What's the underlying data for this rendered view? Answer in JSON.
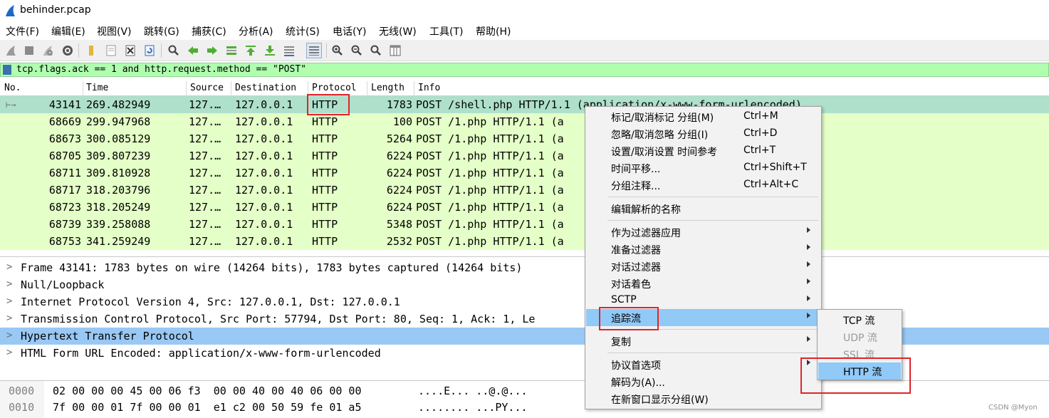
{
  "window": {
    "title": "behinder.pcap"
  },
  "menu": [
    "文件(F)",
    "编辑(E)",
    "视图(V)",
    "跳转(G)",
    "捕获(C)",
    "分析(A)",
    "统计(S)",
    "电话(Y)",
    "无线(W)",
    "工具(T)",
    "帮助(H)"
  ],
  "toolbar": {
    "icons": [
      "shark-fin-start-icon",
      "stop-icon",
      "restart-icon",
      "options-gear-icon",
      "open-file-icon",
      "save-file-icon",
      "close-file-icon",
      "reload-icon",
      "find-packet-icon",
      "go-back-icon",
      "go-forward-icon",
      "go-to-packet-icon",
      "go-first-icon",
      "go-last-icon",
      "autoscroll-icon",
      "colorize-icon",
      "zoom-in-icon",
      "zoom-out-icon",
      "zoom-normal-icon",
      "resize-columns-icon"
    ]
  },
  "filter": {
    "expression": "tcp.flags.ack == 1 and http.request.method == \"POST\""
  },
  "packet_list": {
    "columns": [
      "No.",
      "Time",
      "Source",
      "Destination",
      "Protocol",
      "Length",
      "Info"
    ],
    "rows": [
      {
        "no": "43141",
        "time": "269.482949",
        "src": "127.…",
        "dst": "127.0.0.1",
        "proto": "HTTP",
        "len": "1783",
        "info": "POST /shell.php HTTP/1.1  (application/x-www-form-urlencoded)"
      },
      {
        "no": "68669",
        "time": "299.947968",
        "src": "127.…",
        "dst": "127.0.0.1",
        "proto": "HTTP",
        "len": "100",
        "info": "POST /1.php HTTP/1.1  (a"
      },
      {
        "no": "68673",
        "time": "300.085129",
        "src": "127.…",
        "dst": "127.0.0.1",
        "proto": "HTTP",
        "len": "5264",
        "info": "POST /1.php HTTP/1.1  (a"
      },
      {
        "no": "68705",
        "time": "309.807239",
        "src": "127.…",
        "dst": "127.0.0.1",
        "proto": "HTTP",
        "len": "6224",
        "info": "POST /1.php HTTP/1.1  (a"
      },
      {
        "no": "68711",
        "time": "309.810928",
        "src": "127.…",
        "dst": "127.0.0.1",
        "proto": "HTTP",
        "len": "6224",
        "info": "POST /1.php HTTP/1.1  (a"
      },
      {
        "no": "68717",
        "time": "318.203796",
        "src": "127.…",
        "dst": "127.0.0.1",
        "proto": "HTTP",
        "len": "6224",
        "info": "POST /1.php HTTP/1.1  (a"
      },
      {
        "no": "68723",
        "time": "318.205249",
        "src": "127.…",
        "dst": "127.0.0.1",
        "proto": "HTTP",
        "len": "6224",
        "info": "POST /1.php HTTP/1.1  (a"
      },
      {
        "no": "68739",
        "time": "339.258088",
        "src": "127.…",
        "dst": "127.0.0.1",
        "proto": "HTTP",
        "len": "5348",
        "info": "POST /1.php HTTP/1.1  (a"
      },
      {
        "no": "68753",
        "time": "341.259249",
        "src": "127.…",
        "dst": "127.0.0.1",
        "proto": "HTTP",
        "len": "2532",
        "info": "POST /1.php HTTP/1.1  (a"
      }
    ]
  },
  "details": [
    "Frame 43141: 1783 bytes on wire (14264 bits), 1783 bytes captured (14264 bits)",
    "Null/Loopback",
    "Internet Protocol Version 4, Src: 127.0.0.1, Dst: 127.0.0.1",
    "Transmission Control Protocol, Src Port: 57794, Dst Port: 80, Seq: 1, Ack: 1, Le",
    "Hypertext Transfer Protocol",
    "HTML Form URL Encoded: application/x-www-form-urlencoded"
  ],
  "hex": [
    {
      "offset": "0000",
      "bytes": "02 00 00 00 45 00 06 f3  00 00 40 00 40 06 00 00",
      "ascii": "....E... ..@.@..."
    },
    {
      "offset": "0010",
      "bytes": "7f 00 00 01 7f 00 00 01  e1 c2 00 50 59 fe 01 a5",
      "ascii": "........ ...PY..."
    }
  ],
  "context_menu": [
    {
      "label": "标记/取消标记 分组(M)",
      "shortcut": "Ctrl+M"
    },
    {
      "label": "忽略/取消忽略 分组(I)",
      "shortcut": "Ctrl+D"
    },
    {
      "label": "设置/取消设置 时间参考",
      "shortcut": "Ctrl+T"
    },
    {
      "label": "时间平移...",
      "shortcut": "Ctrl+Shift+T"
    },
    {
      "label": "分组注释...",
      "shortcut": "Ctrl+Alt+C"
    },
    {
      "label": "编辑解析的名称",
      "shortcut": ""
    },
    {
      "label": "作为过滤器应用",
      "shortcut": ""
    },
    {
      "label": "准备过滤器",
      "shortcut": ""
    },
    {
      "label": "对话过滤器",
      "shortcut": ""
    },
    {
      "label": "对话着色",
      "shortcut": ""
    },
    {
      "label": "SCTP",
      "shortcut": ""
    },
    {
      "label": "追踪流",
      "shortcut": ""
    },
    {
      "label": "复制",
      "shortcut": ""
    },
    {
      "label": "协议首选项",
      "shortcut": ""
    },
    {
      "label": "解码为(A)...",
      "shortcut": ""
    },
    {
      "label": "在新窗口显示分组(W)",
      "shortcut": ""
    }
  ],
  "submenu": [
    "TCP 流",
    "UDP 流",
    "SSL 流",
    "HTTP 流"
  ],
  "watermark": "CSDN @Myon⁠",
  "colors": {
    "row_bg": "#e4ffc7",
    "row_selected": "#aee0cc",
    "filter_bg": "#afffaf",
    "detail_selected": "#99c8f4",
    "menu_highlight": "#91c9f7",
    "annotation_red": "#e0242b"
  }
}
